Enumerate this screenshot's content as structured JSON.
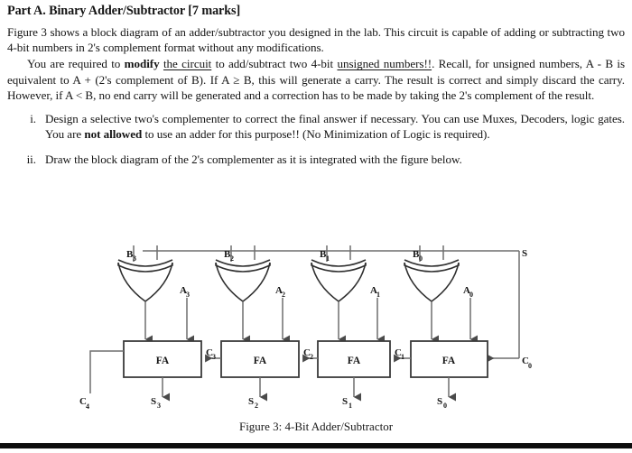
{
  "heading": "Part A. Binary Adder/Subtractor [7 marks]",
  "paragraphs": {
    "p1": "Figure 3 shows a block diagram of an adder/subtractor you designed in the lab. This circuit is capable of adding or subtracting two 4-bit numbers in 2's complement format without any modifications.",
    "p2_a": "You are required to ",
    "p2_bold_modify": "modify",
    "p2_b": " ",
    "p2_underline_circuit": "the circuit",
    "p2_c": " to add/subtract two 4-bit ",
    "p2_underline_unsigned": "unsigned numbers!!",
    "p2_d": ". Recall, for unsigned numbers, A - B is equivalent to A + (2's complement of B). If A ≥ B, this will generate a carry. The result is correct and simply discard the carry. However, if A < B, no end carry will be generated and a correction has to be made by taking the 2's complement of the result."
  },
  "list": [
    {
      "marker": "i.",
      "text_a": "Design a selective two's complementer to correct the final answer if necessary. You can use Muxes, Decoders, logic gates. You are ",
      "bold": "not allowed",
      "text_b": " to use an adder for this purpose!! (No Minimization of Logic is required)."
    },
    {
      "marker": "ii.",
      "text_a": "Draw the block diagram of the 2's complementer as it is integrated with the figure below.",
      "bold": "",
      "text_b": ""
    }
  ],
  "figure": {
    "caption": "Figure 3: 4-Bit Adder/Subtractor",
    "bus_label": "S",
    "carry_in_label": "C",
    "carry_in_sub": "0",
    "carry_out_label": "C",
    "carry_out_sub": "4",
    "blocks": [
      {
        "label": "FA",
        "b_label": "B",
        "b_sub": "3",
        "a_label": "A",
        "a_sub": "3",
        "s_label": "S",
        "s_sub": "3",
        "carry_label": "C",
        "carry_sub": "3"
      },
      {
        "label": "FA",
        "b_label": "B",
        "b_sub": "2",
        "a_label": "A",
        "a_sub": "2",
        "s_label": "S",
        "s_sub": "2",
        "carry_label": "C",
        "carry_sub": "2"
      },
      {
        "label": "FA",
        "b_label": "B",
        "b_sub": "1",
        "a_label": "A",
        "a_sub": "1",
        "s_label": "S",
        "s_sub": "1",
        "carry_label": "C",
        "carry_sub": "1"
      },
      {
        "label": "FA",
        "b_label": "B",
        "b_sub": "0",
        "a_label": "A",
        "a_sub": "0",
        "s_label": "S",
        "s_sub": "0",
        "carry_label": "",
        "carry_sub": ""
      }
    ]
  },
  "colors": {
    "ink": "#141414",
    "wire": "#6e6e6e",
    "box_stroke": "#3a3a3a",
    "rule": "#0d0d0d"
  }
}
